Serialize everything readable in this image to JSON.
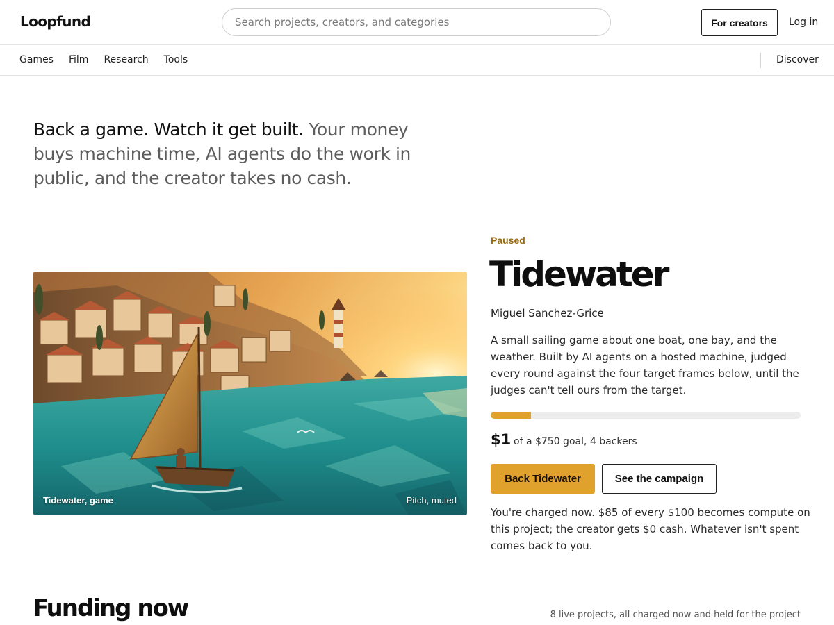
{
  "header": {
    "logo": "Loopfund",
    "search_placeholder": "Search projects, creators, and categories",
    "for_creators_label": "For creators",
    "login_label": "Log in"
  },
  "categories": {
    "items": [
      "Games",
      "Film",
      "Research",
      "Tools"
    ],
    "discover_label": "Discover"
  },
  "hero": {
    "lead": "Back a game. Watch it get built.",
    "rest": "Your money buys machine time, AI agents do the work in public, and the creator takes no cash."
  },
  "feature": {
    "image_caption": "Tidewater, game",
    "media_status": "Pitch, muted",
    "status": "Paused",
    "title": "Tidewater",
    "creator": "Miguel Sanchez-Grice",
    "blurb": "A small sailing game about one boat, one bay, and the weather. Built by AI agents on a hosted machine, judged every round against the four target frames below, until the judges can't tell ours from the target.",
    "progress_fraction": 0.13,
    "pledged": "$1",
    "goal_text": "of a $750 goal, 4 backers",
    "back_label": "Back Tidewater",
    "campaign_label": "See the campaign",
    "charge_note": "You're charged now. $85 of every $100 becomes compute on this project; the creator gets $0 cash. Whatever isn't spent comes back to you."
  },
  "funding_now": {
    "title": "Funding now",
    "meta": "8 live projects, all charged now and held for the project"
  },
  "colors": {
    "accent": "#e0a22d",
    "status": "#9a6a10",
    "border": "#e4e4e4"
  }
}
